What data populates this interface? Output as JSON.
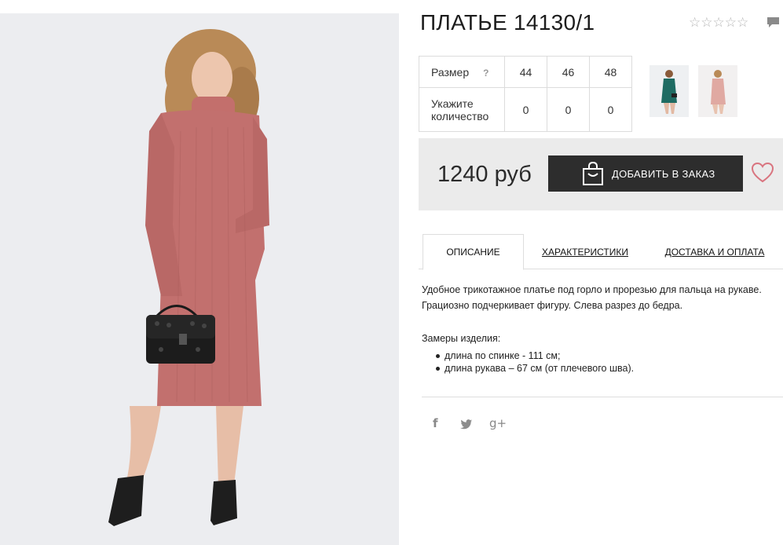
{
  "product": {
    "title": "ПЛАТЬЕ 14130/1",
    "rating_stars": "☆☆☆☆☆",
    "rating_value": 0
  },
  "sizes": {
    "size_label": "Размер",
    "help_mark": "?",
    "quantity_label_line1": "Укажите",
    "quantity_label_line2": "количество",
    "columns": [
      "44",
      "46",
      "48"
    ],
    "quantities": [
      "0",
      "0",
      "0"
    ]
  },
  "thumbnails": [
    "green-dress-thumbnail",
    "pink-dress-thumbnail"
  ],
  "purchase": {
    "price": "1240 руб",
    "add_button_label": "ДОБАВИТЬ В ЗАКАЗ"
  },
  "tabs": [
    {
      "label": "ОПИСАНИЕ",
      "active": true
    },
    {
      "label": "ХАРАКТЕРИСТИКИ",
      "active": false
    },
    {
      "label": "ДОСТАВКА И ОПЛАТА",
      "active": false
    }
  ],
  "description": {
    "line1": "Удобное трикотажное платье под горло и прорезью для пальца на рукаве.",
    "line2": "Грациозно подчеркивает фигуру. Слева разрез до бедра.",
    "measurements_title": "Замеры изделия:",
    "measurements": [
      "длина по спинке - 111 см;",
      "длина рукава – 67 см (от плечевого шва)."
    ]
  },
  "social": {
    "facebook": "f",
    "twitter": "🐦",
    "googleplus": "g+"
  },
  "colors": {
    "dress": "#c2706e",
    "button": "#2d2d2d",
    "heart": "#d9747f",
    "buybox_bg": "#ebebeb"
  }
}
